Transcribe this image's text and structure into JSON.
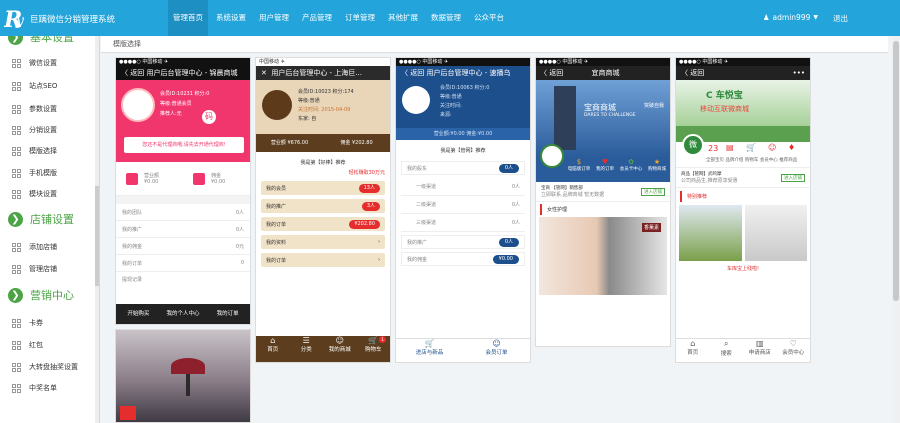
{
  "app": {
    "title": "巨蹒微信分销管理系统"
  },
  "nav": [
    {
      "label": "管理首页",
      "active": true
    },
    {
      "label": "系统设置"
    },
    {
      "label": "用户管理"
    },
    {
      "label": "产品管理"
    },
    {
      "label": "订单管理"
    },
    {
      "label": "其他扩展"
    },
    {
      "label": "数据管理"
    },
    {
      "label": "公众平台"
    }
  ],
  "user": {
    "name": "admin999",
    "logout": "退出"
  },
  "sidebar": {
    "sections": [
      {
        "label": "基本设置",
        "items": [
          "微信设置",
          "站点SEO",
          "参数设置",
          "分销设置",
          "模版选择",
          "手机模版",
          "模块设置"
        ]
      },
      {
        "label": "店铺设置",
        "items": [
          "添加店铺",
          "管理店铺"
        ]
      },
      {
        "label": "营销中心",
        "items": [
          "卡券",
          "红包",
          "大转盘抽奖设置",
          "中奖名单"
        ]
      }
    ]
  },
  "breadcrumb": "模版选择",
  "templates": {
    "t1": {
      "header": "用户后台管理中心 - 锦晨商城",
      "back": "〈 返回",
      "member_id": "会员ID:10231  积分:0",
      "level": "等级:普通会员",
      "parent": "推荐人:无",
      "alert": "您还不是代理商哦,请先去开通代理商!",
      "wallet": [
        {
          "label": "营业额",
          "value": "¥0.00"
        },
        {
          "label": "佣金",
          "value": "¥0.00"
        }
      ],
      "rows": [
        {
          "label": "我的团队",
          "value": "0人"
        },
        {
          "label": "我的推广",
          "value": "0人"
        },
        {
          "label": "我的佣金",
          "value": "0元"
        },
        {
          "label": "我的订单",
          "value": "0"
        },
        {
          "label": "提现记录",
          "value": ""
        }
      ],
      "tabs": [
        "开始购买",
        "我的个人中心",
        "我的订单"
      ]
    },
    "t2": {
      "header": "用户后台管理中心 - 上海巨...",
      "member_id": "会员ID:10023  积分:174",
      "level": "等级:普通",
      "date": "关注时间: 2015-04-09",
      "region": "东家: 自",
      "money": [
        {
          "label": "营业额",
          "value": "¥676.00"
        },
        {
          "label": "佣金",
          "value": "¥202.80"
        }
      ],
      "section": "我是第【好棒】推荐",
      "menu": [
        {
          "label": "我的会员",
          "badge": "13人"
        },
        {
          "label": "我的推广",
          "badge": "3人"
        },
        {
          "label": "我的订单",
          "badge": "¥202.80"
        },
        {
          "label": "我的资料",
          "badge": ""
        },
        {
          "label": "我的订单",
          "badge": ""
        }
      ],
      "tabs": [
        "首页",
        "分类",
        "我的商城",
        "购物车"
      ],
      "cart_count": "1"
    },
    "t3": {
      "header": "用户后台管理中心 - 速播乌",
      "back": "〈 返回",
      "member_id": "会员ID:10063  积分:0",
      "level": "等级:普通",
      "date": "关注时间:",
      "region": "来源:",
      "stats": "营业额:¥0.00          佣金:¥0.00",
      "section": "我是第【管网】推荐",
      "rows": [
        {
          "label": "我的股东",
          "value": "0人"
        },
        {
          "label": "一级渠道",
          "value": "0人"
        },
        {
          "label": "二级渠道",
          "value": "0人"
        },
        {
          "label": "三级渠道",
          "value": "0人"
        },
        {
          "label": "我的推广",
          "value": "0人"
        },
        {
          "label": "我的佣金",
          "value": "¥0.00"
        }
      ],
      "tabs": [
        "进店与新品",
        "会员订单"
      ]
    },
    "t4": {
      "header": "宜商商城",
      "back": "〈 返回",
      "banner": "宝商商城",
      "banner_sub": "DARES TO CHALLENGE",
      "banner_right": "突破自我",
      "icons": [
        "电脑版订单",
        "我的订单",
        "会员卡中心",
        "购物商城"
      ],
      "shop": "宝商 【管网】销售部",
      "shop_desc": "立即联系,品牌商城 暂无数据",
      "btn": "进入店铺",
      "section": "女性护理",
      "product": "香薰素"
    },
    "t5": {
      "back": "〈 返回",
      "brand": "车悦宝",
      "slogan": "移动互联微商城",
      "num": "23",
      "nav": [
        "全部宝贝",
        "品牌介绍",
        "购物车",
        "会员中心",
        "推荐商品"
      ],
      "shop": "商品【管网】武鸣摩",
      "shop_desc": "公司商品生,推荐原享受惠",
      "btn": "进入店铺",
      "section": "特别推荐",
      "tag": "车库宝上线啦!",
      "tabs": [
        "首页",
        "搜索",
        "申请商店",
        "会员中心"
      ]
    }
  }
}
